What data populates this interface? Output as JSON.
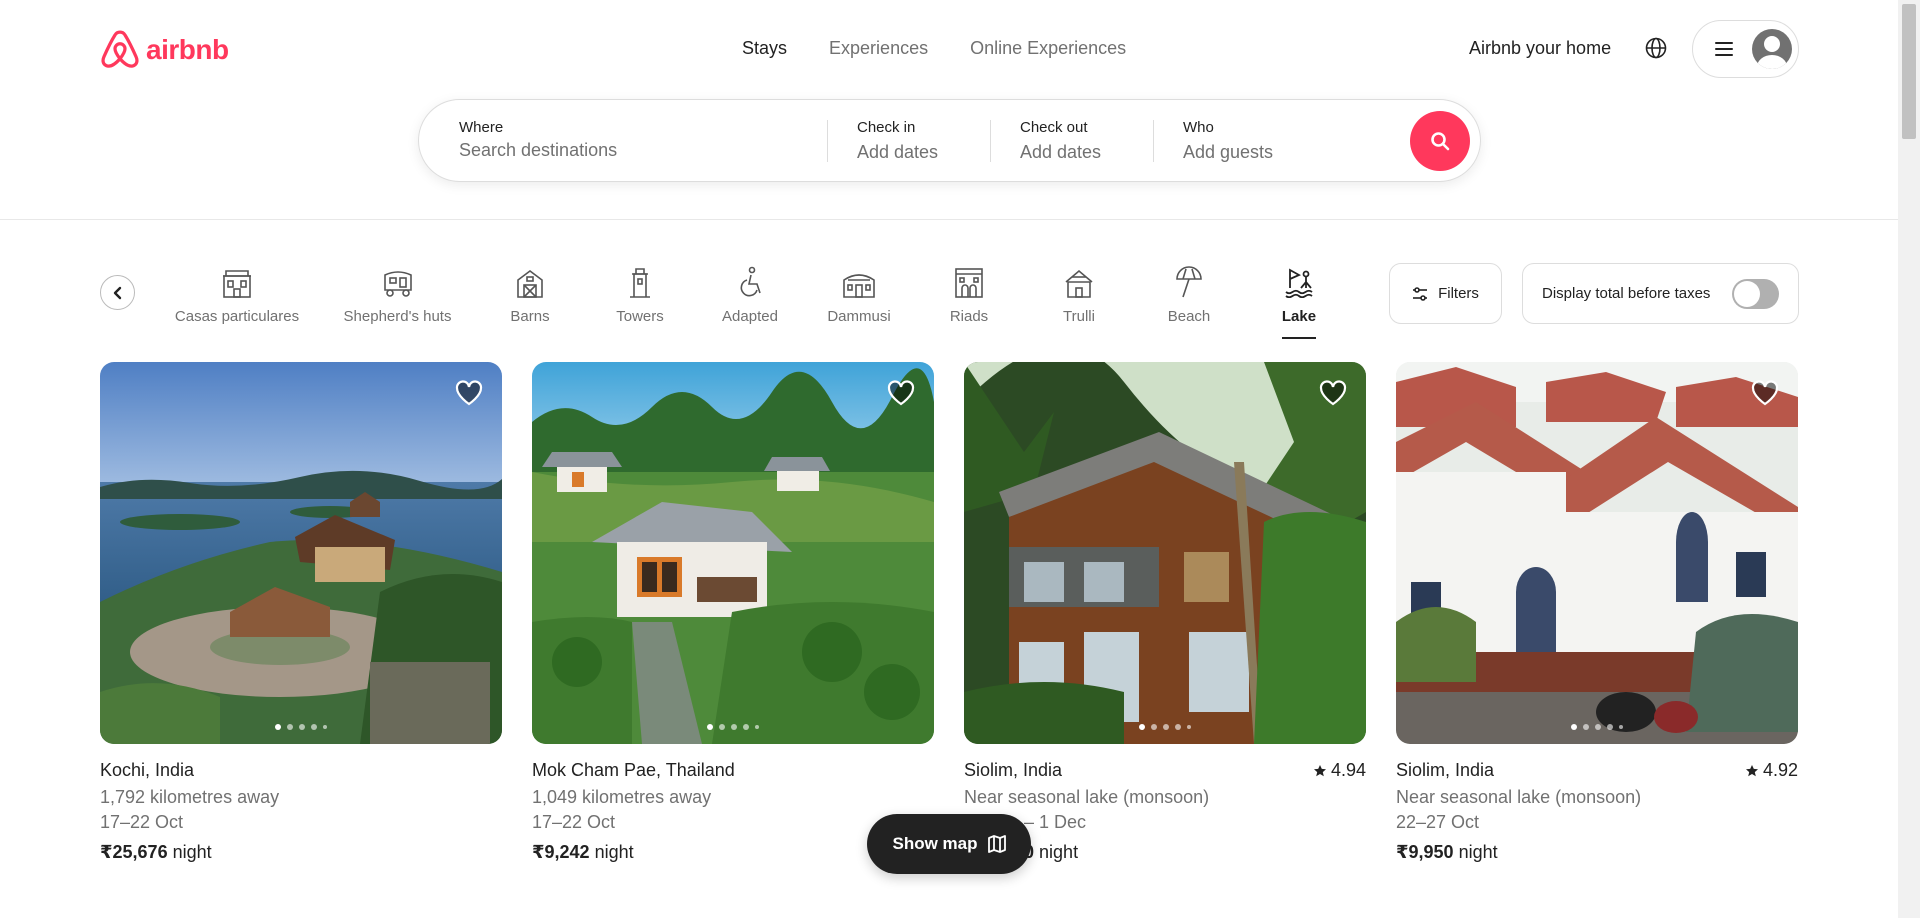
{
  "brand": {
    "name": "airbnb",
    "color": "#ff385c"
  },
  "nav": {
    "tabs": [
      "Stays",
      "Experiences",
      "Online Experiences"
    ],
    "active": "Stays"
  },
  "header": {
    "host_link": "Airbnb your home",
    "globe_icon": "globe-icon",
    "menu_icon": "hamburger-icon",
    "avatar_icon": "user-avatar-icon"
  },
  "search": {
    "where": {
      "label": "Where",
      "placeholder": "Search destinations"
    },
    "checkin": {
      "label": "Check in",
      "value": "Add dates"
    },
    "checkout": {
      "label": "Check out",
      "value": "Add dates"
    },
    "who": {
      "label": "Who",
      "value": "Add guests"
    },
    "button_icon": "search-icon"
  },
  "categories": {
    "items": [
      "Casas particulares",
      "Shepherd's huts",
      "Barns",
      "Towers",
      "Adapted",
      "Dammusi",
      "Riads",
      "Trulli",
      "Beach",
      "Lake"
    ],
    "active": "Lake",
    "filters_label": "Filters",
    "tax_toggle_label": "Display total before taxes",
    "tax_toggle_on": false
  },
  "listings": [
    {
      "location": "Kochi, India",
      "rating": "",
      "line1": "1,792 kilometres away",
      "line2": "17–22 Oct",
      "price": "₹25,676",
      "price_unit": "night"
    },
    {
      "location": "Mok Cham Pae, Thailand",
      "rating": "",
      "line1": "1,049 kilometres away",
      "line2": "17–22 Oct",
      "price": "₹9,242",
      "price_unit": "night"
    },
    {
      "location": "Siolim, India",
      "rating": "4.94",
      "line1": "Near seasonal lake (monsoon)",
      "line2": "– 1 Dec",
      "price": "0",
      "price_unit": "night"
    },
    {
      "location": "Siolim, India",
      "rating": "4.92",
      "line1": "Near seasonal lake (monsoon)",
      "line2": "22–27 Oct",
      "price": "₹9,950",
      "price_unit": "night"
    }
  ],
  "show_map": {
    "label": "Show map",
    "icon": "map-icon"
  }
}
